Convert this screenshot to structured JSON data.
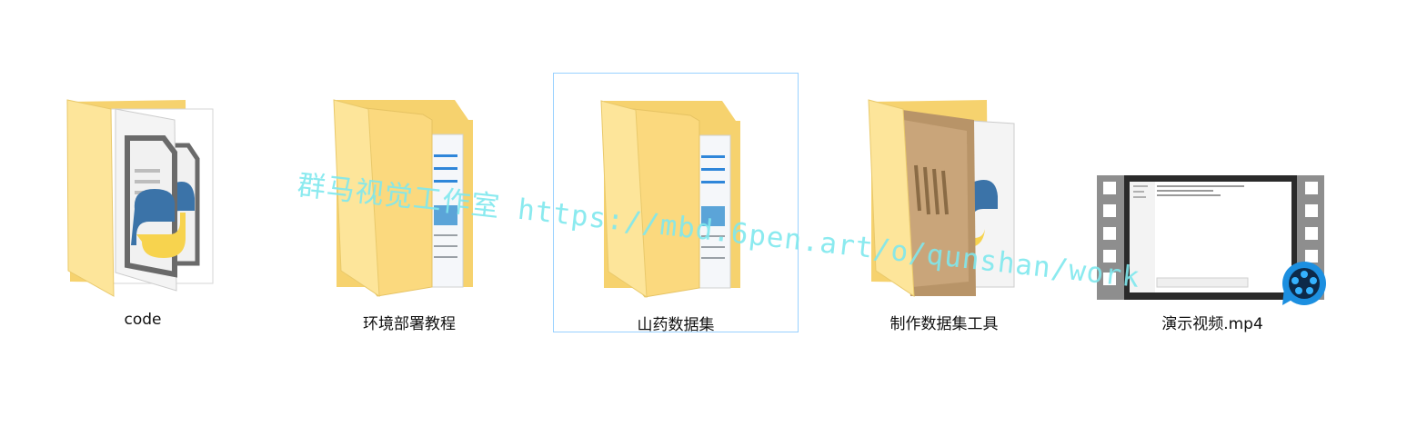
{
  "items": [
    {
      "name": "code",
      "type": "folder",
      "preview": "python-file"
    },
    {
      "name": "环境部署教程",
      "type": "folder",
      "preview": "document"
    },
    {
      "name": "山药数据集",
      "type": "folder",
      "preview": "document",
      "selected": true
    },
    {
      "name": "制作数据集工具",
      "type": "folder",
      "preview": "image-and-python"
    },
    {
      "name": "演示视频.mp4",
      "type": "video",
      "preview": "video-thumbnail"
    }
  ],
  "watermark": "群马视觉工作室 https://mbd.6pen.art/o/qunshan/work",
  "colors": {
    "folder_back": "#f6d26e",
    "folder_front": "#fde59a",
    "selection_border": "#99d1ff",
    "python_blue": "#3b73a8",
    "python_yellow": "#f7d34e",
    "player_blue": "#1c8fe0",
    "watermark": "#7fe8ee"
  }
}
